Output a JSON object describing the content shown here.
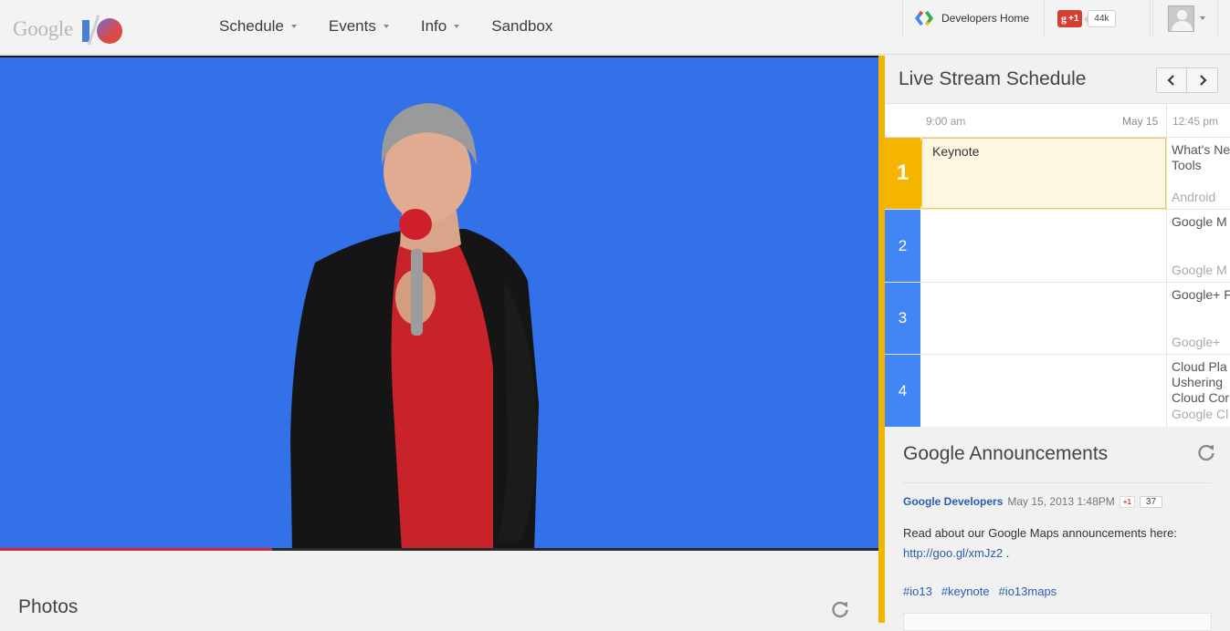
{
  "header": {
    "logo_text": "Google",
    "nav": [
      {
        "label": "Schedule",
        "dropdown": true
      },
      {
        "label": "Events",
        "dropdown": true
      },
      {
        "label": "Info",
        "dropdown": true
      },
      {
        "label": "Sandbox",
        "dropdown": false
      }
    ],
    "developers_home": "Developers Home",
    "plus_one": "+1",
    "plus_count": "44k",
    "icons": [
      "developers-logo-icon",
      "google-plus-icon",
      "avatar-icon",
      "chevron-down-icon"
    ]
  },
  "video": {
    "progress_fraction": 0.31,
    "progress_color": "#cc2a36",
    "background_color": "#2f6fe6"
  },
  "photos": {
    "title": "Photos"
  },
  "schedule": {
    "title": "Live Stream Schedule",
    "times": {
      "start": "9:00 am",
      "date": "May 15",
      "next": "12:45 pm"
    },
    "rows": [
      {
        "number": "1",
        "current": "Keynote",
        "next_title": "What's Ne\nTools",
        "next_sub": "Android"
      },
      {
        "number": "2",
        "current": "",
        "next_title": "Google M",
        "next_sub": "Google M"
      },
      {
        "number": "3",
        "current": "",
        "next_title": "Google+ F",
        "next_sub": "Google+"
      },
      {
        "number": "4",
        "current": "",
        "next_title": "Cloud Pla\nUshering\nCloud Cor",
        "next_sub": "Google Cl"
      }
    ],
    "colors": {
      "active": "#f4b400",
      "inactive": "#4285f4"
    }
  },
  "announcements": {
    "title": "Google Announcements",
    "author": "Google Developers",
    "date": "May 15, 2013 1:48PM",
    "plus_one": "+1",
    "plus_count": "37",
    "text_before": "Read about our Google Maps announcements here:",
    "link": "http://goo.gl/xmJz2",
    "text_after": ".",
    "tags": [
      "#io13",
      "#keynote",
      "#io13maps"
    ]
  }
}
